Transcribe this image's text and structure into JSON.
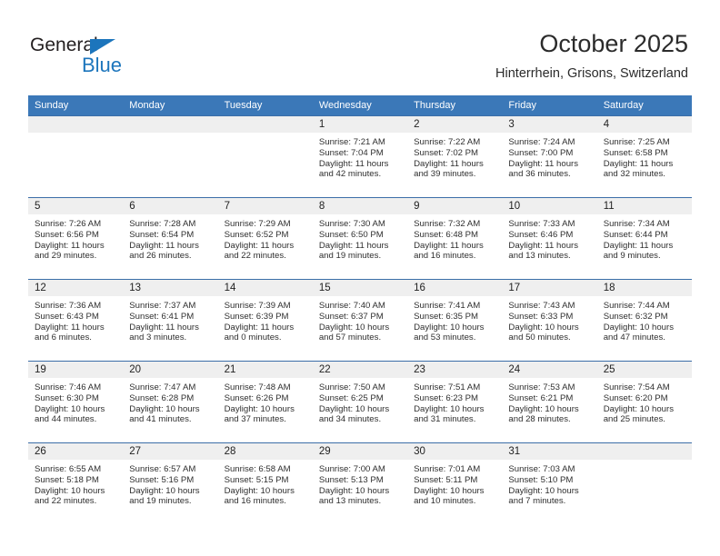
{
  "brand": {
    "name_top": "General",
    "name_bottom": "Blue",
    "accent_color": "#1c75bc"
  },
  "header": {
    "title": "October 2025",
    "location": "Hinterrhein, Grisons, Switzerland"
  },
  "calendar": {
    "header_bg": "#3b78b8",
    "daynum_bg": "#efefef",
    "weekdays": [
      "Sunday",
      "Monday",
      "Tuesday",
      "Wednesday",
      "Thursday",
      "Friday",
      "Saturday"
    ],
    "weeks": [
      [
        {
          "day": "",
          "sunrise": "",
          "sunset": "",
          "daylight": "",
          "daylight2": ""
        },
        {
          "day": "",
          "sunrise": "",
          "sunset": "",
          "daylight": "",
          "daylight2": ""
        },
        {
          "day": "",
          "sunrise": "",
          "sunset": "",
          "daylight": "",
          "daylight2": ""
        },
        {
          "day": "1",
          "sunrise": "Sunrise: 7:21 AM",
          "sunset": "Sunset: 7:04 PM",
          "daylight": "Daylight: 11 hours",
          "daylight2": "and 42 minutes."
        },
        {
          "day": "2",
          "sunrise": "Sunrise: 7:22 AM",
          "sunset": "Sunset: 7:02 PM",
          "daylight": "Daylight: 11 hours",
          "daylight2": "and 39 minutes."
        },
        {
          "day": "3",
          "sunrise": "Sunrise: 7:24 AM",
          "sunset": "Sunset: 7:00 PM",
          "daylight": "Daylight: 11 hours",
          "daylight2": "and 36 minutes."
        },
        {
          "day": "4",
          "sunrise": "Sunrise: 7:25 AM",
          "sunset": "Sunset: 6:58 PM",
          "daylight": "Daylight: 11 hours",
          "daylight2": "and 32 minutes."
        }
      ],
      [
        {
          "day": "5",
          "sunrise": "Sunrise: 7:26 AM",
          "sunset": "Sunset: 6:56 PM",
          "daylight": "Daylight: 11 hours",
          "daylight2": "and 29 minutes."
        },
        {
          "day": "6",
          "sunrise": "Sunrise: 7:28 AM",
          "sunset": "Sunset: 6:54 PM",
          "daylight": "Daylight: 11 hours",
          "daylight2": "and 26 minutes."
        },
        {
          "day": "7",
          "sunrise": "Sunrise: 7:29 AM",
          "sunset": "Sunset: 6:52 PM",
          "daylight": "Daylight: 11 hours",
          "daylight2": "and 22 minutes."
        },
        {
          "day": "8",
          "sunrise": "Sunrise: 7:30 AM",
          "sunset": "Sunset: 6:50 PM",
          "daylight": "Daylight: 11 hours",
          "daylight2": "and 19 minutes."
        },
        {
          "day": "9",
          "sunrise": "Sunrise: 7:32 AM",
          "sunset": "Sunset: 6:48 PM",
          "daylight": "Daylight: 11 hours",
          "daylight2": "and 16 minutes."
        },
        {
          "day": "10",
          "sunrise": "Sunrise: 7:33 AM",
          "sunset": "Sunset: 6:46 PM",
          "daylight": "Daylight: 11 hours",
          "daylight2": "and 13 minutes."
        },
        {
          "day": "11",
          "sunrise": "Sunrise: 7:34 AM",
          "sunset": "Sunset: 6:44 PM",
          "daylight": "Daylight: 11 hours",
          "daylight2": "and 9 minutes."
        }
      ],
      [
        {
          "day": "12",
          "sunrise": "Sunrise: 7:36 AM",
          "sunset": "Sunset: 6:43 PM",
          "daylight": "Daylight: 11 hours",
          "daylight2": "and 6 minutes."
        },
        {
          "day": "13",
          "sunrise": "Sunrise: 7:37 AM",
          "sunset": "Sunset: 6:41 PM",
          "daylight": "Daylight: 11 hours",
          "daylight2": "and 3 minutes."
        },
        {
          "day": "14",
          "sunrise": "Sunrise: 7:39 AM",
          "sunset": "Sunset: 6:39 PM",
          "daylight": "Daylight: 11 hours",
          "daylight2": "and 0 minutes."
        },
        {
          "day": "15",
          "sunrise": "Sunrise: 7:40 AM",
          "sunset": "Sunset: 6:37 PM",
          "daylight": "Daylight: 10 hours",
          "daylight2": "and 57 minutes."
        },
        {
          "day": "16",
          "sunrise": "Sunrise: 7:41 AM",
          "sunset": "Sunset: 6:35 PM",
          "daylight": "Daylight: 10 hours",
          "daylight2": "and 53 minutes."
        },
        {
          "day": "17",
          "sunrise": "Sunrise: 7:43 AM",
          "sunset": "Sunset: 6:33 PM",
          "daylight": "Daylight: 10 hours",
          "daylight2": "and 50 minutes."
        },
        {
          "day": "18",
          "sunrise": "Sunrise: 7:44 AM",
          "sunset": "Sunset: 6:32 PM",
          "daylight": "Daylight: 10 hours",
          "daylight2": "and 47 minutes."
        }
      ],
      [
        {
          "day": "19",
          "sunrise": "Sunrise: 7:46 AM",
          "sunset": "Sunset: 6:30 PM",
          "daylight": "Daylight: 10 hours",
          "daylight2": "and 44 minutes."
        },
        {
          "day": "20",
          "sunrise": "Sunrise: 7:47 AM",
          "sunset": "Sunset: 6:28 PM",
          "daylight": "Daylight: 10 hours",
          "daylight2": "and 41 minutes."
        },
        {
          "day": "21",
          "sunrise": "Sunrise: 7:48 AM",
          "sunset": "Sunset: 6:26 PM",
          "daylight": "Daylight: 10 hours",
          "daylight2": "and 37 minutes."
        },
        {
          "day": "22",
          "sunrise": "Sunrise: 7:50 AM",
          "sunset": "Sunset: 6:25 PM",
          "daylight": "Daylight: 10 hours",
          "daylight2": "and 34 minutes."
        },
        {
          "day": "23",
          "sunrise": "Sunrise: 7:51 AM",
          "sunset": "Sunset: 6:23 PM",
          "daylight": "Daylight: 10 hours",
          "daylight2": "and 31 minutes."
        },
        {
          "day": "24",
          "sunrise": "Sunrise: 7:53 AM",
          "sunset": "Sunset: 6:21 PM",
          "daylight": "Daylight: 10 hours",
          "daylight2": "and 28 minutes."
        },
        {
          "day": "25",
          "sunrise": "Sunrise: 7:54 AM",
          "sunset": "Sunset: 6:20 PM",
          "daylight": "Daylight: 10 hours",
          "daylight2": "and 25 minutes."
        }
      ],
      [
        {
          "day": "26",
          "sunrise": "Sunrise: 6:55 AM",
          "sunset": "Sunset: 5:18 PM",
          "daylight": "Daylight: 10 hours",
          "daylight2": "and 22 minutes."
        },
        {
          "day": "27",
          "sunrise": "Sunrise: 6:57 AM",
          "sunset": "Sunset: 5:16 PM",
          "daylight": "Daylight: 10 hours",
          "daylight2": "and 19 minutes."
        },
        {
          "day": "28",
          "sunrise": "Sunrise: 6:58 AM",
          "sunset": "Sunset: 5:15 PM",
          "daylight": "Daylight: 10 hours",
          "daylight2": "and 16 minutes."
        },
        {
          "day": "29",
          "sunrise": "Sunrise: 7:00 AM",
          "sunset": "Sunset: 5:13 PM",
          "daylight": "Daylight: 10 hours",
          "daylight2": "and 13 minutes."
        },
        {
          "day": "30",
          "sunrise": "Sunrise: 7:01 AM",
          "sunset": "Sunset: 5:11 PM",
          "daylight": "Daylight: 10 hours",
          "daylight2": "and 10 minutes."
        },
        {
          "day": "31",
          "sunrise": "Sunrise: 7:03 AM",
          "sunset": "Sunset: 5:10 PM",
          "daylight": "Daylight: 10 hours",
          "daylight2": "and 7 minutes."
        },
        {
          "day": "",
          "sunrise": "",
          "sunset": "",
          "daylight": "",
          "daylight2": ""
        }
      ]
    ]
  }
}
